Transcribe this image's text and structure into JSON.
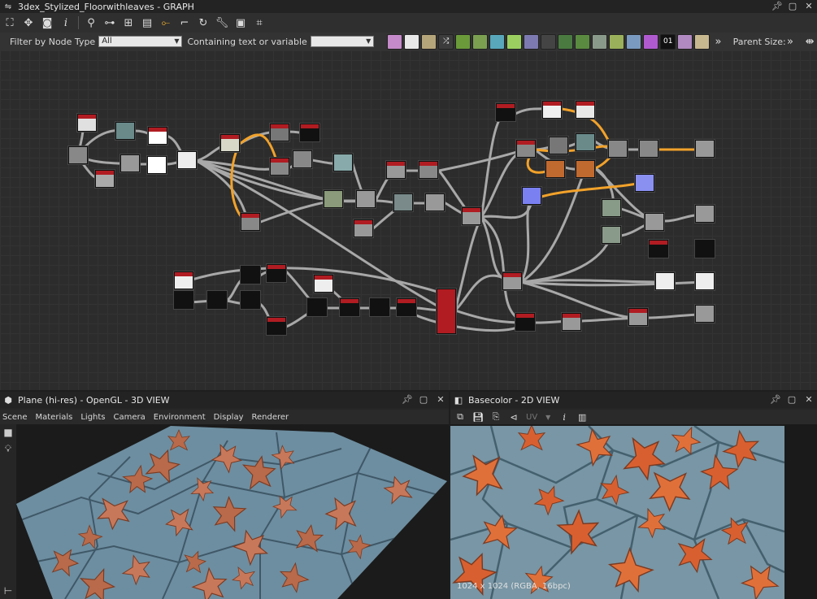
{
  "graph": {
    "title": "3dex_Stylized_Floorwithleaves - GRAPH",
    "filter_label": "Filter by Node Type",
    "filter_value": "All",
    "containing_label": "Containing text or variable",
    "containing_value": "",
    "parent_size_label": "Parent Size:",
    "toolbar_icons": [
      "graph-menu-icon",
      "frame-all-icon",
      "pan-icon",
      "screenshot-icon",
      "info-icon",
      "search-icon",
      "link-icon",
      "hierarchy-icon",
      "layers-icon",
      "connection-icon",
      "align-icon",
      "refresh-icon",
      "wrench-icon",
      "display-icon",
      "crop-icon"
    ],
    "node_swatches": [
      {
        "name": "bitmap-icon",
        "color": "#c58ac9",
        "glyph": ""
      },
      {
        "name": "svg-icon",
        "color": "#e8e8e8",
        "glyph": ""
      },
      {
        "name": "uniform-color-icon",
        "color": "#b5a57a",
        "glyph": ""
      },
      {
        "name": "shuffle-icon",
        "color": "#3c3c3c",
        "glyph": "⤮"
      },
      {
        "name": "curve-icon",
        "color": "#6b9a3a",
        "glyph": ""
      },
      {
        "name": "blend-icon",
        "color": "#7aa050",
        "glyph": ""
      },
      {
        "name": "transform-icon",
        "color": "#58a7ba",
        "glyph": ""
      },
      {
        "name": "gradient-icon",
        "color": "#9bd060",
        "glyph": ""
      },
      {
        "name": "circle-icon",
        "color": "#7c7ab0",
        "glyph": ""
      },
      {
        "name": "grid-icon",
        "color": "#444",
        "glyph": ""
      },
      {
        "name": "plant-icon",
        "color": "#4a7a40",
        "glyph": ""
      },
      {
        "name": "tree-icon",
        "color": "#5a8a40",
        "glyph": ""
      },
      {
        "name": "eye-icon",
        "color": "#8a9a8a",
        "glyph": ""
      },
      {
        "name": "sphere-icon",
        "color": "#9ab05a",
        "glyph": ""
      },
      {
        "name": "levels-icon",
        "color": "#7a9abf",
        "glyph": ""
      },
      {
        "name": "color-wheel-icon",
        "color": "#b05ad0",
        "glyph": ""
      },
      {
        "name": "binary-icon",
        "color": "#111",
        "glyph": "01"
      },
      {
        "name": "warp-icon",
        "color": "#b08ac0",
        "glyph": ""
      },
      {
        "name": "warning-icon",
        "color": "#c8b890",
        "glyph": ""
      }
    ]
  },
  "view3d": {
    "title": "Plane (hi-res) - OpenGL - 3D VIEW",
    "menu": [
      "Scene",
      "Materials",
      "Lights",
      "Camera",
      "Environment",
      "Display",
      "Renderer"
    ]
  },
  "view2d": {
    "title": "Basecolor - 2D VIEW",
    "uv_label": "UV",
    "info": "1024 x 1024 (RGBA, 16bpc)"
  },
  "colors": {
    "node_header": "#b01c22",
    "wire": "#9a9a9a",
    "wire_highlight": "#f0a030"
  }
}
